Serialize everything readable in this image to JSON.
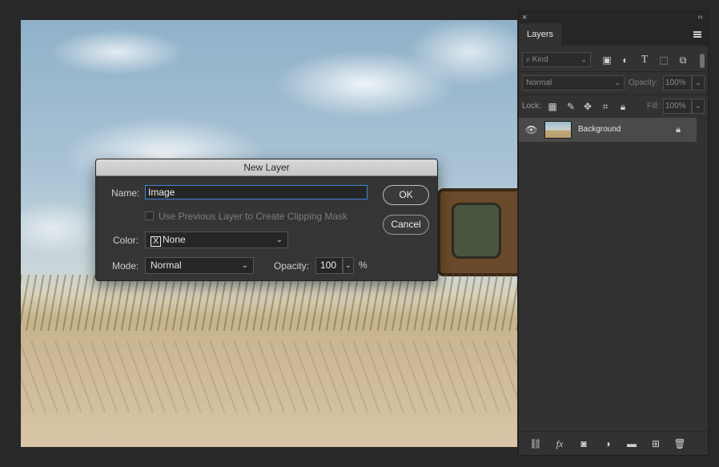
{
  "panel": {
    "close_glyph": "×",
    "collapse_glyph": "‹‹",
    "tab_label": "Layers",
    "filter": {
      "label": "Kind",
      "icon": "search-icon"
    },
    "filter_icons": [
      "image-filter-icon",
      "adjustment-filter-icon",
      "type-filter-icon",
      "shape-filter-icon",
      "smart-object-filter-icon"
    ],
    "blend_mode": "Normal",
    "opacity_label": "Opacity:",
    "opacity_value": "100%",
    "lock_label": "Lock:",
    "fill_label": "Fill:",
    "fill_value": "100%",
    "layers": [
      {
        "name": "Background",
        "visible": true,
        "locked": true
      }
    ],
    "footer_icons": [
      "link-layers-icon",
      "fx-icon",
      "add-mask-icon",
      "adjustment-layer-icon",
      "new-group-icon",
      "new-layer-icon",
      "delete-layer-icon"
    ],
    "fx_text": "fx"
  },
  "dialog": {
    "title": "New Layer",
    "name_label": "Name:",
    "name_value": "Image",
    "clipping_label": "Use Previous Layer to Create Clipping Mask",
    "clipping_checked": false,
    "color_label": "Color:",
    "color_value": "None",
    "color_x": "X",
    "mode_label": "Mode:",
    "mode_value": "Normal",
    "opacity_label": "Opacity:",
    "opacity_value": "100",
    "percent_sign": "%",
    "ok_label": "OK",
    "cancel_label": "Cancel"
  },
  "colors": {
    "focus_blue": "#3f82d8",
    "panel_bg": "#323232",
    "app_bg": "#282828"
  }
}
